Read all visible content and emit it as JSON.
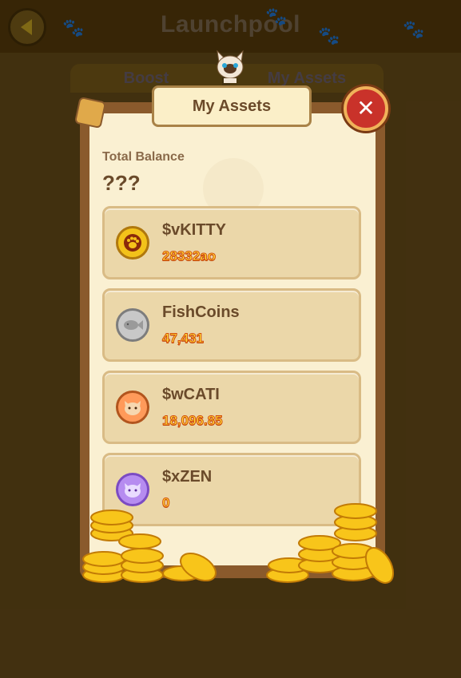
{
  "header": {
    "title": "Launchpool",
    "back_icon": "back-arrow-icon"
  },
  "tabs": [
    {
      "label": "Boost"
    },
    {
      "label": "My Assets"
    }
  ],
  "modal": {
    "title": "My Assets",
    "close_icon": "close-icon",
    "total_balance_label": "Total Balance",
    "total_balance_value": "???"
  },
  "assets": [
    {
      "name": "$vKITTY",
      "amount": "28332ao",
      "icon": "paw-coin-icon"
    },
    {
      "name": "FishCoins",
      "amount": "47,431",
      "icon": "fish-coin-icon"
    },
    {
      "name": "$wCATI",
      "amount": "18,096.85",
      "icon": "cat-coin-icon"
    },
    {
      "name": "$xZEN",
      "amount": "0",
      "icon": "zen-cat-coin-icon"
    }
  ],
  "colors": {
    "modal_frame": "#8a5a2c",
    "modal_bg": "#faf0d2",
    "card_bg": "#ebd7a9",
    "amount_text": "#ffe23a",
    "close_button": "#c9322a"
  }
}
